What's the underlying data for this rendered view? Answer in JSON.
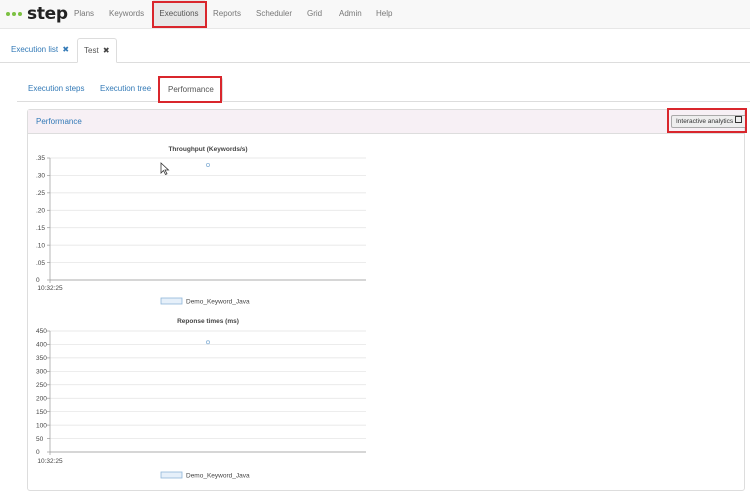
{
  "nav": {
    "brand": "step",
    "items": [
      "Plans",
      "Keywords",
      "Executions",
      "Reports",
      "Scheduler",
      "Grid",
      "Admin",
      "Help"
    ]
  },
  "tabs": [
    {
      "label": "Execution list"
    },
    {
      "label": "Test"
    }
  ],
  "subtabs": [
    "Execution steps",
    "Execution tree",
    "Performance"
  ],
  "panel": {
    "title": "Performance",
    "analytics_button": "Interactive analytics"
  },
  "colors": {
    "accent": "#337ab7",
    "highlight": "#d9262c",
    "series": "#8fb6d9"
  },
  "chart_data": [
    {
      "type": "scatter",
      "title": "Throughput (Keywords/s)",
      "x_tick": "10:32:25",
      "y_ticks": [
        "0",
        ".05",
        ".10",
        ".15",
        ".20",
        ".25",
        ".30",
        ".35"
      ],
      "ylim": [
        0,
        0.35
      ],
      "series": [
        {
          "name": "Demo_Keyword_Java",
          "points": [
            {
              "y": 0.33
            }
          ]
        }
      ],
      "legend": "bottom"
    },
    {
      "type": "scatter",
      "title": "Reponse times (ms)",
      "x_tick": "10:32:25",
      "y_ticks": [
        "0",
        "50",
        "100",
        "150",
        "200",
        "250",
        "300",
        "350",
        "400",
        "450"
      ],
      "ylim": [
        0,
        450
      ],
      "series": [
        {
          "name": "Demo_Keyword_Java",
          "points": [
            {
              "y": 408
            }
          ]
        }
      ],
      "legend": "bottom"
    }
  ]
}
